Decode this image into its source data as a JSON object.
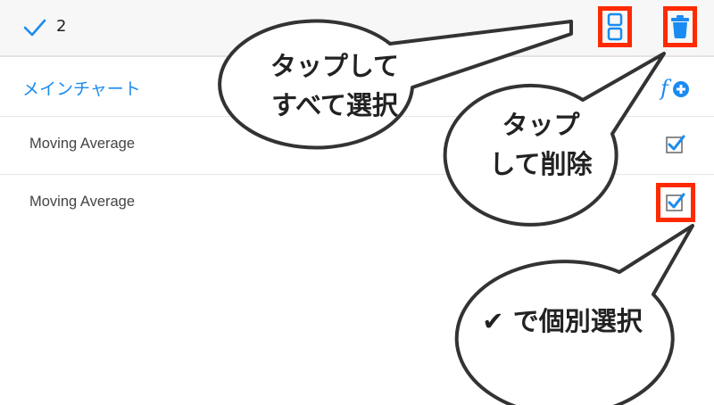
{
  "toolbar": {
    "selected_count": "2",
    "check_icon": "checkmark-icon",
    "select_all_icon": "select-all-grid-icon",
    "delete_icon": "trash-icon"
  },
  "section": {
    "title": "メインチャート",
    "add_icon": "add-function-icon"
  },
  "rows": [
    {
      "label": "Moving Average",
      "checked": true
    },
    {
      "label": "Moving Average",
      "checked": true
    }
  ],
  "callouts": {
    "select_all": [
      "タップして",
      "すべて選択"
    ],
    "delete": [
      "タップ",
      "して削除"
    ],
    "individual": [
      "✔ で個別選択"
    ]
  },
  "colors": {
    "accent": "#1a8bf0",
    "highlight": "#ff2a00"
  }
}
